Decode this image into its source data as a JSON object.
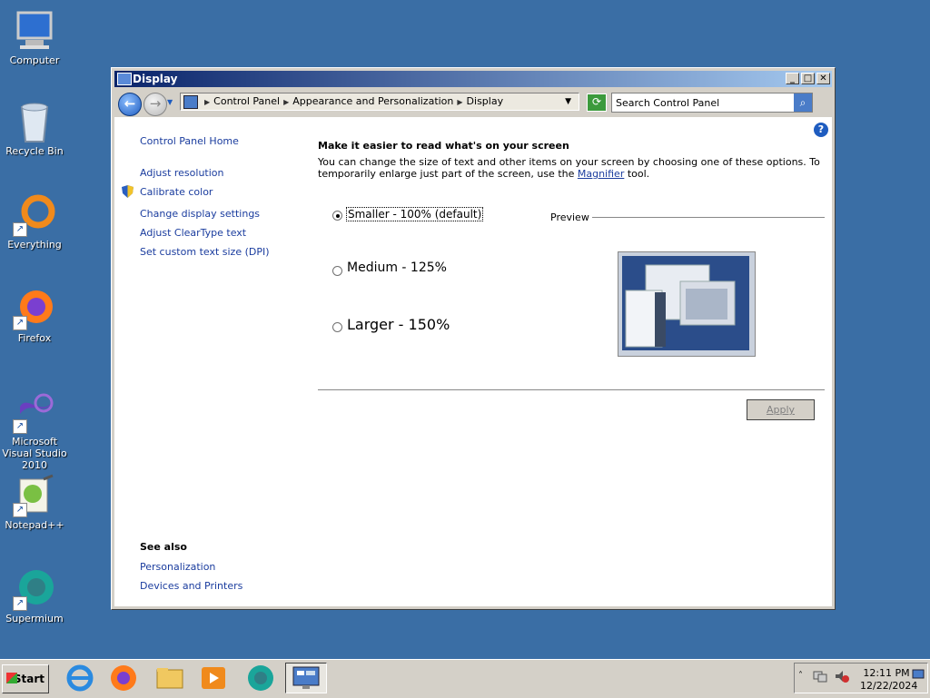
{
  "desktop": {
    "icons": [
      {
        "label": "Computer",
        "icon": "computer-icon"
      },
      {
        "label": "Recycle Bin",
        "icon": "recycle-bin-icon"
      },
      {
        "label": "Everything",
        "icon": "everything-icon"
      },
      {
        "label": "Firefox",
        "icon": "firefox-icon"
      },
      {
        "label": "Microsoft Visual Studio 2010",
        "icon": "visual-studio-icon"
      },
      {
        "label": "Notepad++",
        "icon": "notepadpp-icon"
      },
      {
        "label": "Supermium",
        "icon": "supermium-icon"
      }
    ]
  },
  "window": {
    "title": "Display",
    "controls": {
      "minimize": "_",
      "maximize": "□",
      "close": "✕"
    },
    "address": {
      "crumbs": [
        "Control Panel",
        "Appearance and Personalization",
        "Display"
      ]
    },
    "search": {
      "placeholder": "Search Control Panel"
    },
    "help": "?",
    "left_nav": {
      "home": "Control Panel Home",
      "links": [
        "Adjust resolution",
        "Calibrate color",
        "Change display settings",
        "Adjust ClearType text",
        "Set custom text size (DPI)"
      ],
      "see_also_title": "See also",
      "see_also": [
        "Personalization",
        "Devices and Printers"
      ]
    },
    "main": {
      "heading": "Make it easier to read what's on your screen",
      "desc_part1": "You can change the size of text and other items on your screen by choosing one of these options. To temporarily enlarge just part of the screen, use the ",
      "desc_link": "Magnifier",
      "desc_part2": " tool.",
      "options": [
        {
          "label": "Smaller - 100% (default)",
          "selected": true
        },
        {
          "label": "Medium - 125%",
          "selected": false
        },
        {
          "label": "Larger - 150%",
          "selected": false
        }
      ],
      "preview_label": "Preview",
      "apply_label": "Apply"
    }
  },
  "taskbar": {
    "start_label": "Start",
    "apps": [
      "internet-explorer-icon",
      "firefox-icon",
      "file-explorer-icon",
      "media-player-icon",
      "supermium-icon",
      "control-panel-icon"
    ],
    "clock_time": "12:11 PM",
    "clock_date": "12/22/2024"
  }
}
